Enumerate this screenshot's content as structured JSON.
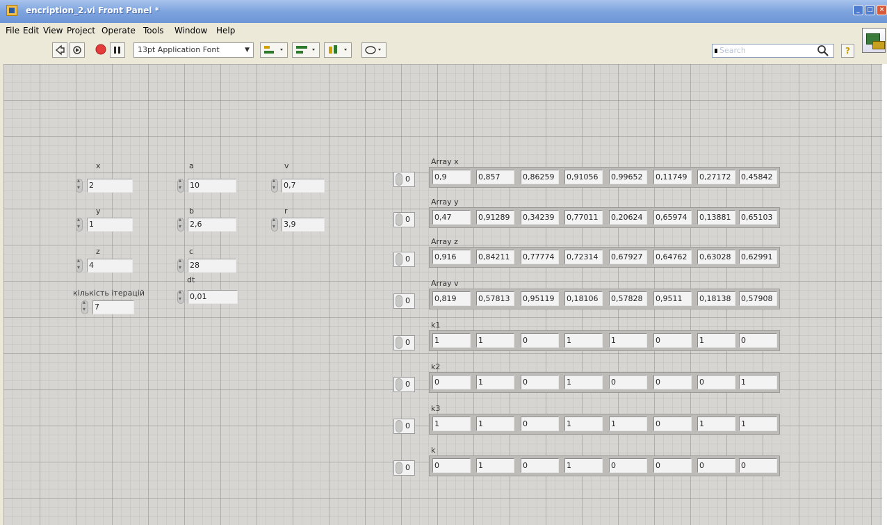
{
  "window": {
    "title": "encription_2.vi Front Panel *"
  },
  "menu": [
    "File",
    "Edit",
    "View",
    "Project",
    "Operate",
    "Tools",
    "Window",
    "Help"
  ],
  "toolbar": {
    "font_label": "13pt Application Font",
    "search_placeholder": "Search",
    "help_glyph": "?"
  },
  "controls": {
    "x": {
      "label": "x",
      "value": "2"
    },
    "y": {
      "label": "y",
      "value": "1"
    },
    "z": {
      "label": "z",
      "value": "4"
    },
    "iterations": {
      "label": "кількість ітерацій",
      "value": "7"
    },
    "a": {
      "label": "a",
      "value": "10"
    },
    "b": {
      "label": "b",
      "value": "2,6"
    },
    "c": {
      "label": "c",
      "value": "28"
    },
    "dt": {
      "label": "dt",
      "value": "0,01"
    },
    "v": {
      "label": "v",
      "value": "0,7"
    },
    "r": {
      "label": "r",
      "value": "3,9"
    }
  },
  "arrays": [
    {
      "label": "Array x",
      "index": "0",
      "values": [
        "0,9",
        "0,857",
        "0,86259",
        "0,91056",
        "0,99652",
        "0,11749",
        "0,27172",
        "0,45842"
      ]
    },
    {
      "label": "Array y",
      "index": "0",
      "values": [
        "0,47",
        "0,91289",
        "0,34239",
        "0,77011",
        "0,20624",
        "0,65974",
        "0,13881",
        "0,65103"
      ]
    },
    {
      "label": "Array z",
      "index": "0",
      "values": [
        "0,916",
        "0,84211",
        "0,77774",
        "0,72314",
        "0,67927",
        "0,64762",
        "0,63028",
        "0,62991"
      ]
    },
    {
      "label": "Array v",
      "index": "0",
      "values": [
        "0,819",
        "0,57813",
        "0,95119",
        "0,18106",
        "0,57828",
        "0,9511",
        "0,18138",
        "0,57908"
      ]
    },
    {
      "label": "k1",
      "index": "0",
      "values": [
        "1",
        "1",
        "0",
        "1",
        "1",
        "0",
        "1",
        "0"
      ]
    },
    {
      "label": "k2",
      "index": "0",
      "values": [
        "0",
        "1",
        "0",
        "1",
        "0",
        "0",
        "0",
        "1"
      ]
    },
    {
      "label": "k3",
      "index": "0",
      "values": [
        "1",
        "1",
        "0",
        "1",
        "1",
        "0",
        "1",
        "1"
      ]
    },
    {
      "label": "k",
      "index": "0",
      "values": [
        "0",
        "1",
        "0",
        "1",
        "0",
        "0",
        "0",
        "0"
      ]
    }
  ]
}
